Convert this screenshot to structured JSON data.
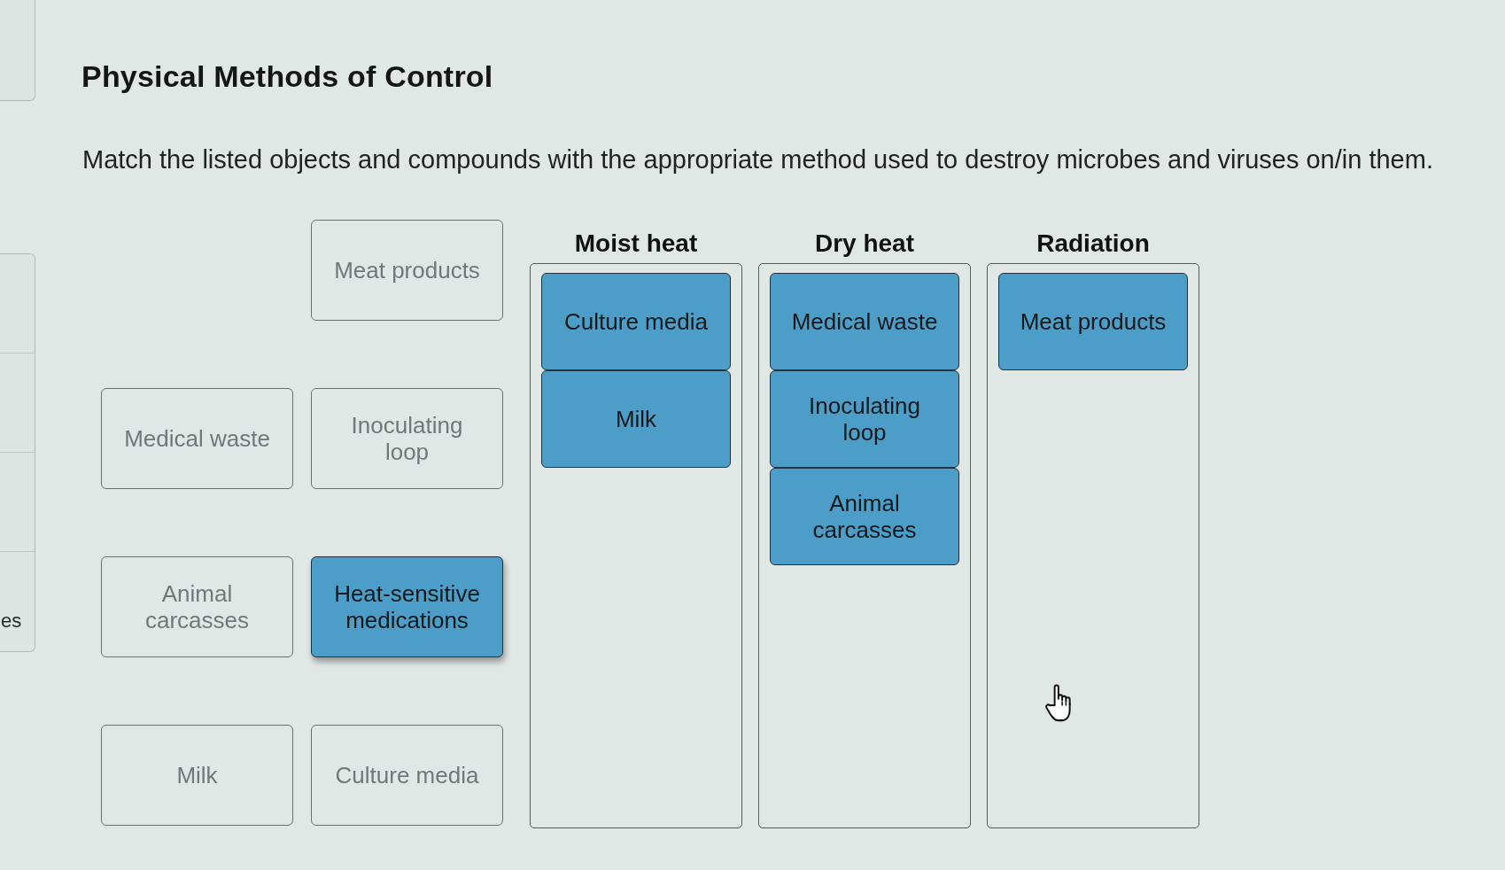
{
  "title": "Physical Methods of Control",
  "instructions": "Match the listed objects and compounds with the appropriate method used to destroy microbes and viruses on/in them.",
  "side_panel": {
    "text": "es"
  },
  "answer_pool": [
    {
      "label": "Meat products",
      "placed": true
    },
    {
      "label": "Medical waste",
      "placed": true
    },
    {
      "label": "Inoculating loop",
      "placed": true
    },
    {
      "label": "Animal carcasses",
      "placed": true
    },
    {
      "label": "Heat-sensitive medications",
      "placed": false
    },
    {
      "label": "Milk",
      "placed": true
    },
    {
      "label": "Culture media",
      "placed": true
    }
  ],
  "categories": [
    {
      "heading": "Moist heat",
      "items": [
        "Culture media",
        "Milk"
      ]
    },
    {
      "heading": "Dry heat",
      "items": [
        "Medical waste",
        "Inoculating loop",
        "Animal carcasses"
      ]
    },
    {
      "heading": "Radiation",
      "items": [
        "Meat products"
      ]
    }
  ]
}
